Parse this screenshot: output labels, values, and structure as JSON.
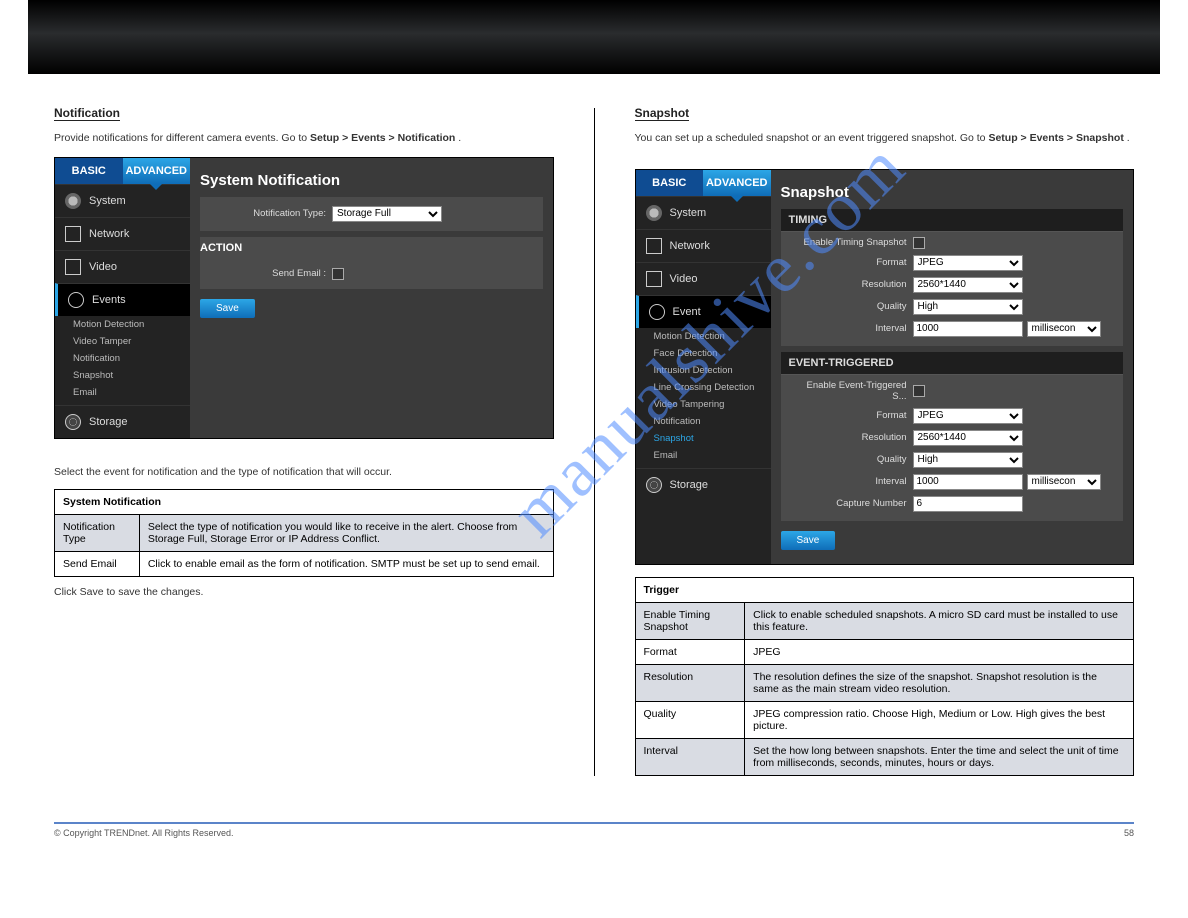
{
  "watermark": "manualshive.com",
  "left": {
    "title": "Notification",
    "intro1_prefix": "Provide notifications for different camera events. Go to ",
    "intro1_bold": "Setup > Events > Notification",
    "intro1_suffix": ".",
    "shot": {
      "tabs": {
        "basic": "BASIC",
        "advanced": "ADVANCED"
      },
      "side": {
        "system": "System",
        "network": "Network",
        "video": "Video",
        "events": "Events",
        "storage": "Storage"
      },
      "subs": {
        "motion": "Motion Detection",
        "tamper": "Video Tamper",
        "notif": "Notification",
        "snapshot": "Snapshot",
        "email": "Email"
      },
      "panel": "System Notification",
      "notif_type_label": "Notification Type:",
      "notif_type_value": "Storage Full",
      "action": "ACTION",
      "send_email": "Send Email :",
      "save": "Save"
    },
    "after1": "Select the event for notification and the type of notification that will occur.",
    "table_caption": "System Notification",
    "row1_h": "Notification Type",
    "row1_v": "Select the type of notification you would like to receive in the alert. Choose from Storage Full, Storage Error or IP Address Conflict.",
    "row2_h": "Send Email",
    "row2_v": "Click to enable email as the form of notification. SMTP must be set up to send email.",
    "after2": "Click Save to save the changes."
  },
  "right": {
    "title": "Snapshot",
    "intro_prefix": "You can set up a scheduled snapshot or an event triggered snapshot. Go to ",
    "intro_bold": "Setup > Events > Snapshot",
    "intro_suffix": ".",
    "shot": {
      "tabs": {
        "basic": "BASIC",
        "advanced": "ADVANCED"
      },
      "side": {
        "system": "System",
        "network": "Network",
        "video": "Video",
        "event": "Event",
        "storage": "Storage"
      },
      "subs": {
        "motion": "Motion Detection",
        "face": "Face Detection",
        "intr": "Intrusion Detection",
        "line": "Line Crossing Detection",
        "vtamp": "Video Tampering",
        "notif": "Notification",
        "snapshot": "Snapshot",
        "email": "Email"
      },
      "panel": "Snapshot",
      "timing": "TIMING",
      "enable_timing": "Enable Timing Snapshot",
      "format_l": "Format",
      "format_v": "JPEG",
      "res_l": "Resolution",
      "res_v": "2560*1440",
      "qual_l": "Quality",
      "qual_v": "High",
      "int_l": "Interval",
      "int_v": "1000",
      "int_unit": "millisecon",
      "event": "EVENT-TRIGGERED",
      "enable_event": "Enable Event-Triggered S...",
      "cap_l": "Capture Number",
      "cap_v": "6",
      "save": "Save"
    },
    "table_caption": "Trigger",
    "rows": {
      "r1h": "Enable Timing Snapshot",
      "r1v": "Click to enable scheduled snapshots. A micro SD card must be installed to use this feature.",
      "r2h": "Format",
      "r2v": "JPEG",
      "r3h": "Resolution",
      "r3v": "The resolution defines the size of the snapshot. Snapshot resolution is the same as the main stream video resolution.",
      "r4h": "Quality",
      "r4v": "JPEG compression ratio. Choose High, Medium or Low. High gives the best picture.",
      "r5h": "Interval",
      "r5v": "Set the how long between snapshots. Enter the time and select the unit of time from milliseconds, seconds, minutes, hours or days."
    }
  },
  "footer": {
    "copy": "© Copyright TRENDnet. All Rights Reserved.",
    "page": "58"
  }
}
